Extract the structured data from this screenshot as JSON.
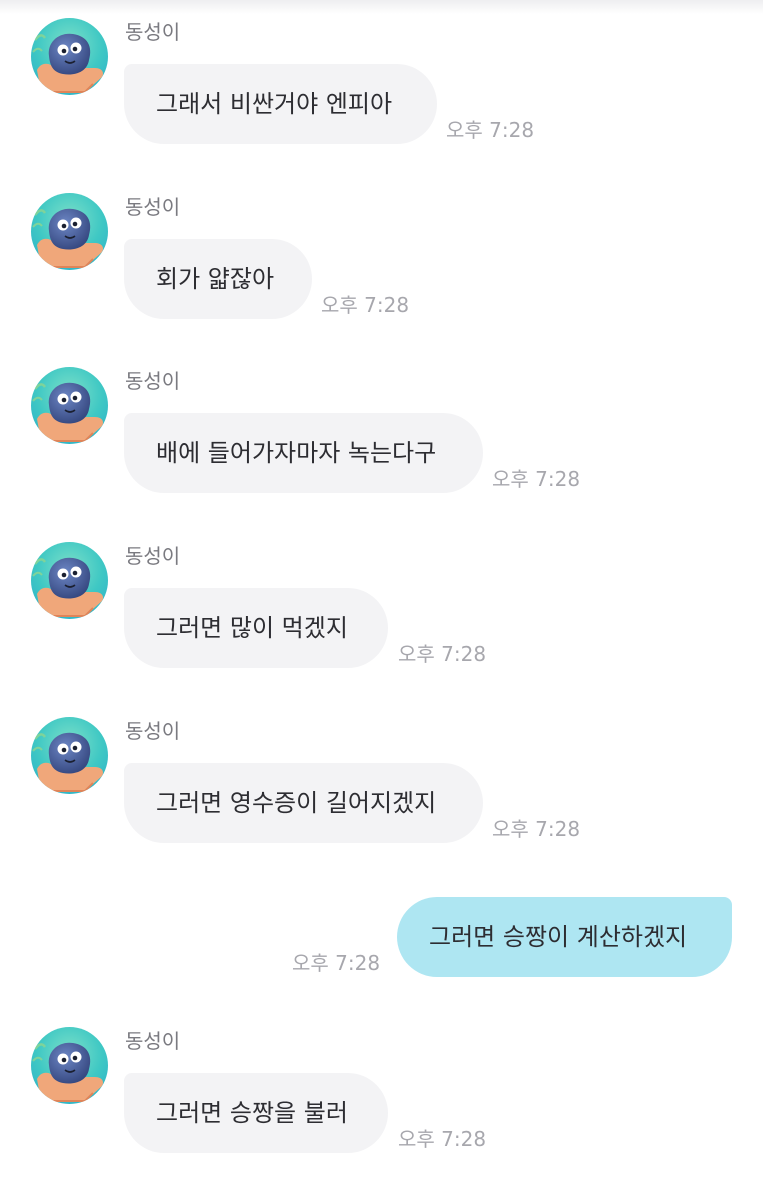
{
  "colors": {
    "incoming_bubble": "#f3f3f5",
    "outgoing_bubble": "#aee6f2",
    "timestamp": "#a7a7ad",
    "sender_name": "#7a7a80"
  },
  "avatar_icon": "rock-character-avatar-icon",
  "messages": [
    {
      "sender": "동성이",
      "text": "그래서 비싼거야 엔피아",
      "time": "오후 7:28"
    },
    {
      "sender": "동성이",
      "text": "회가 얇잖아",
      "time": "오후 7:28"
    },
    {
      "sender": "동성이",
      "text": "배에 들어가자마자 녹는다구",
      "time": "오후 7:28"
    },
    {
      "sender": "동성이",
      "text": "그러면 많이 먹겠지",
      "time": "오후 7:28"
    },
    {
      "sender": "동성이",
      "text": "그러면 영수증이 길어지겠지",
      "time": "오후 7:28"
    },
    {
      "text": "그러면 승짱이 계산하겠지",
      "time": "오후 7:28"
    },
    {
      "sender": "동성이",
      "text": "그러면 승짱을 불러",
      "time": "오후 7:28"
    }
  ]
}
